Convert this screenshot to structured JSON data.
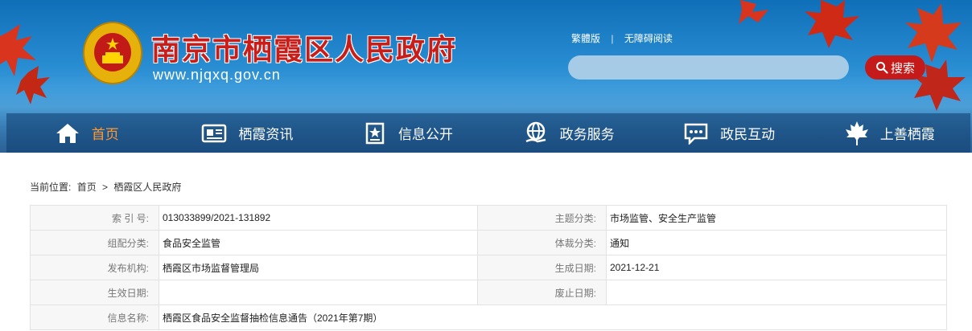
{
  "header": {
    "site_name": "南京市栖霞区人民政府",
    "site_url": "www.njqxq.gov.cn",
    "links": [
      "繁體版",
      "无障碍阅读"
    ],
    "search_placeholder": "",
    "search_button": "搜索",
    "colors": {
      "accent_red": "#c41a1a",
      "active_nav": "#ff9a33"
    }
  },
  "nav": {
    "items": [
      {
        "label": "首页",
        "icon": "home-icon"
      },
      {
        "label": "栖霞资讯",
        "icon": "news-icon"
      },
      {
        "label": "信息公开",
        "icon": "info-public-icon"
      },
      {
        "label": "政务服务",
        "icon": "globe-hand-icon"
      },
      {
        "label": "政民互动",
        "icon": "chat-icon"
      },
      {
        "label": "上善栖霞",
        "icon": "maple-leaf-icon"
      }
    ]
  },
  "breadcrumb": {
    "prefix": "当前位置:",
    "items": [
      "首页",
      ">",
      "栖霞区人民政府"
    ]
  },
  "meta": {
    "rows": [
      [
        {
          "label": "索 引 号:",
          "value": "013033899/2021-131892"
        },
        {
          "label": "主题分类:",
          "value": "市场监管、安全生产监管"
        }
      ],
      [
        {
          "label": "组配分类:",
          "value": "食品安全监管"
        },
        {
          "label": "体裁分类:",
          "value": "通知"
        }
      ],
      [
        {
          "label": "发布机构:",
          "value": "栖霞区市场监督管理局"
        },
        {
          "label": "生成日期:",
          "value": "2021-12-21"
        }
      ],
      [
        {
          "label": "生效日期:",
          "value": ""
        },
        {
          "label": "废止日期:",
          "value": ""
        }
      ]
    ],
    "title_label": "信息名称:",
    "title_value": "栖霞区食品安全监督抽检信息通告（2021年第7期）"
  }
}
